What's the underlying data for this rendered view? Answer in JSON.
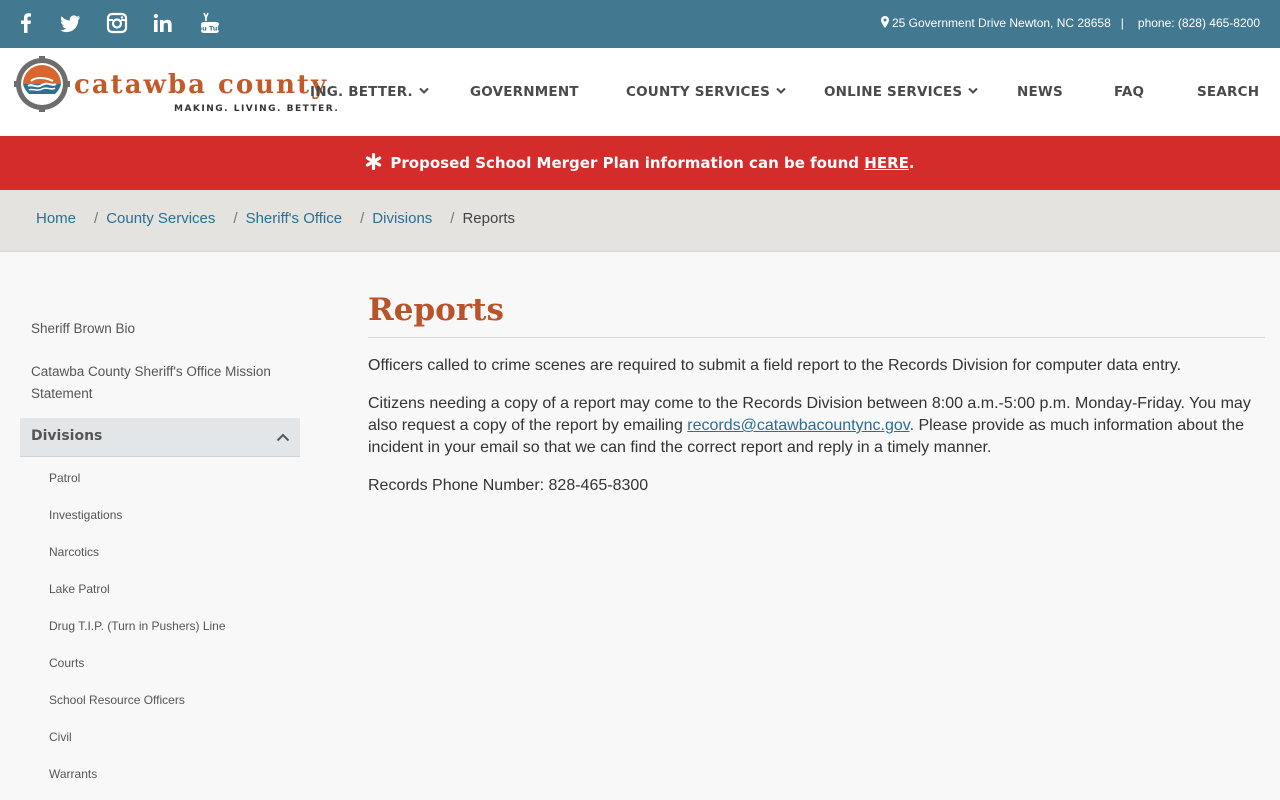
{
  "topbar": {
    "social_icons": [
      "facebook-icon",
      "twitter-icon",
      "instagram-icon",
      "linkedin-icon",
      "youtube-icon"
    ],
    "youtube_text": "You Tube",
    "address": "25 Government Drive Newton, NC 28658",
    "separator": "|",
    "phone": "phone: (828) 465-8200"
  },
  "header": {
    "logo_name": "catawba county",
    "logo_tagline": "MAKING. LIVING. BETTER.",
    "nav": [
      {
        "label": "ING. BETTER.",
        "has_dropdown": true
      },
      {
        "label": "GOVERNMENT",
        "has_dropdown": false
      },
      {
        "label": "COUNTY SERVICES",
        "has_dropdown": true
      },
      {
        "label": "ONLINE SERVICES",
        "has_dropdown": true
      },
      {
        "label": "NEWS",
        "has_dropdown": false
      },
      {
        "label": "FAQ",
        "has_dropdown": false
      },
      {
        "label": "SEARCH",
        "has_dropdown": false
      }
    ]
  },
  "alert": {
    "text": "Proposed School Merger Plan information can be found ",
    "link": "HERE",
    "end": "."
  },
  "breadcrumb": {
    "items": [
      "Home",
      "County Services",
      "Sheriff's Office",
      "Divisions"
    ],
    "separator": "/",
    "current": "Reports"
  },
  "sidebar": {
    "links": [
      "Sheriff Brown Bio",
      "Catawba County Sheriff's Office Mission Statement"
    ],
    "active": "Divisions",
    "sub_links": [
      "Patrol",
      "Investigations",
      "Narcotics",
      "Lake Patrol",
      "Drug T.I.P. (Turn in Pushers) Line",
      "Courts",
      "School Resource Officers",
      "Civil",
      "Warrants"
    ]
  },
  "main": {
    "title": "Reports",
    "p1": "Officers called to crime scenes are required to submit a field report to the Records Division for computer data entry.",
    "p2_before": "Citizens needing a copy of a report may come to the Records Division between 8:00 a.m.-5:00 p.m. Monday-Friday. You may also request a copy of the report by emailing ",
    "p2_link": "records@catawbacountync.gov",
    "p2_after": ". Please provide as much information about the incident in your email so that we can find the correct report and reply in a timely manner.",
    "p3": "Records Phone Number: 828-465-8300"
  },
  "colors": {
    "topbar": "#437891",
    "alert": "#d42b2b",
    "brand_orange": "#b9532a",
    "link": "#2a6f94"
  }
}
